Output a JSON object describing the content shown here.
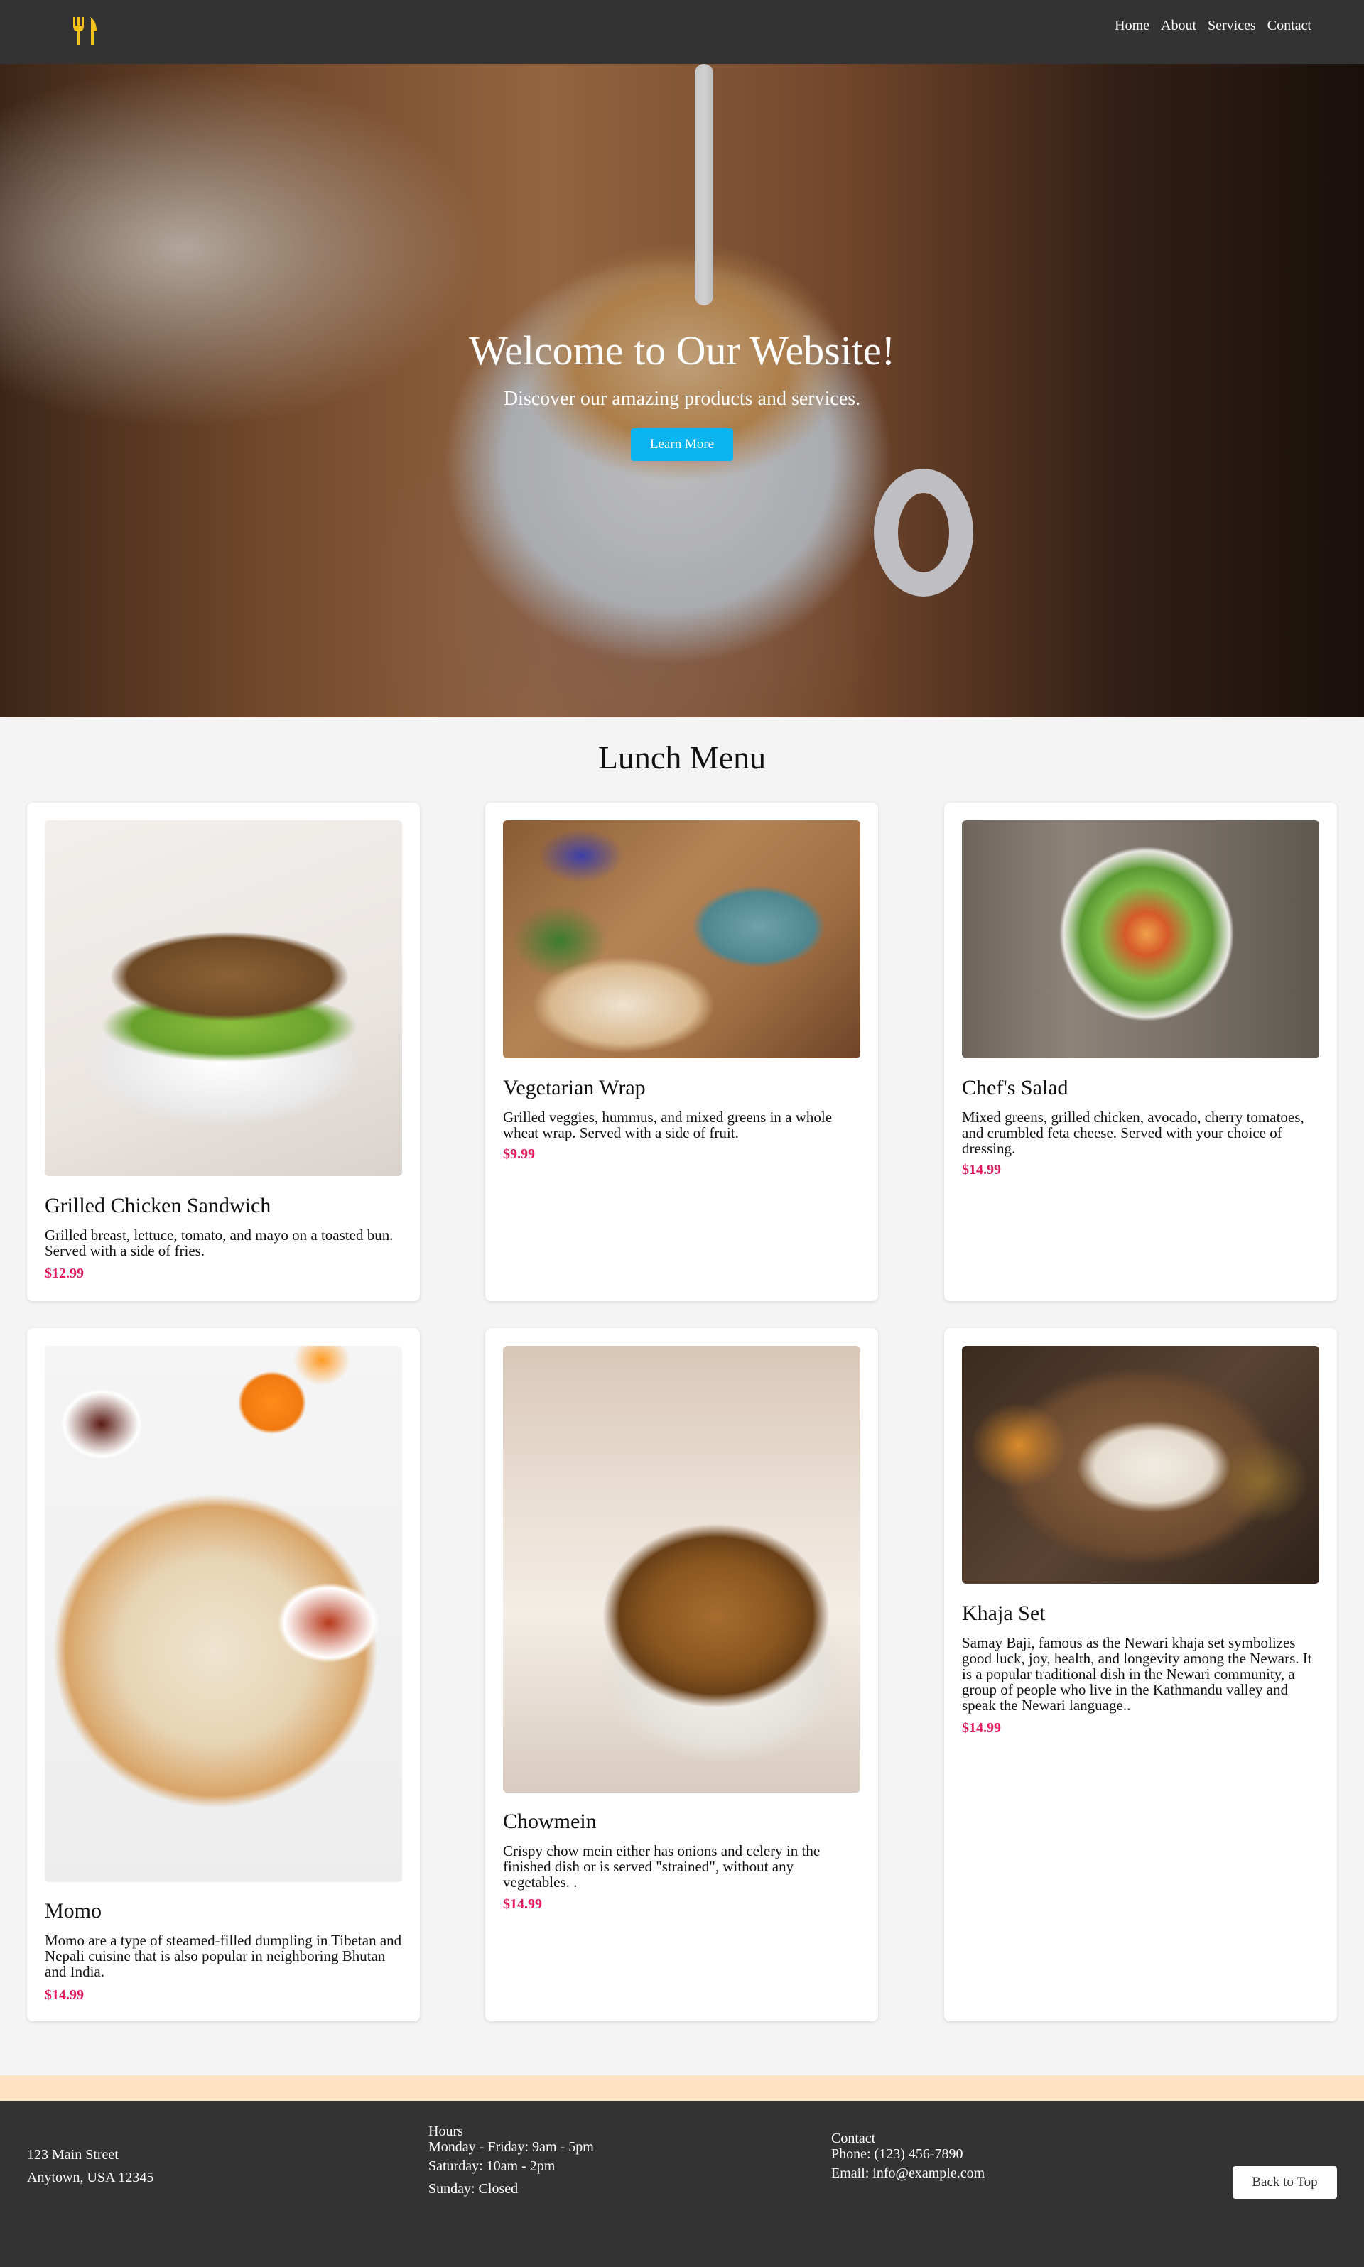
{
  "nav": {
    "logo_icon": "fork-knife-icon",
    "logo_color": "#f5c21b",
    "links": [
      "Home",
      "About",
      "Services",
      "Contact"
    ]
  },
  "hero": {
    "title": "Welcome to Our Website!",
    "subtitle": "Discover our amazing products and services.",
    "button_label": "Learn More",
    "button_color": "#0ab4f0"
  },
  "menu": {
    "title": "Lunch Menu",
    "items": [
      {
        "name": "Grilled Chicken Sandwich",
        "description": "Grilled breast, lettuce, tomato, and mayo on a toasted bun. Served with a side of fries.",
        "price": "$12.99"
      },
      {
        "name": "Vegetarian Wrap",
        "description": "Grilled veggies, hummus, and mixed greens in a whole wheat wrap. Served with a side of fruit.",
        "price": "$9.99"
      },
      {
        "name": "Chef's Salad",
        "description": "Mixed greens, grilled chicken, avocado, cherry tomatoes, and crumbled feta cheese. Served with your choice of dressing.",
        "price": "$14.99"
      },
      {
        "name": "Momo",
        "description": "Momo are a type of steamed-filled dumpling in Tibetan and Nepali cuisine that is also popular in neighboring Bhutan and India.",
        "price": "$14.99"
      },
      {
        "name": "Chowmein",
        "description": "Crispy chow mein either has onions and celery in the finished dish or is served \"strained\", without any vegetables. .",
        "price": "$14.99"
      },
      {
        "name": "Khaja Set",
        "description": "Samay Baji, famous as the Newari khaja set symbolizes good luck, joy, health, and longevity among the Newars. It is a popular traditional dish in the Newari community, a group of people who live in the Kathmandu valley and speak the Newari language..",
        "price": "$14.99"
      }
    ],
    "price_color": "#e2195b"
  },
  "footer": {
    "address": [
      "123 Main Street",
      "Anytown, USA 12345"
    ],
    "hours_title": "Hours",
    "hours": [
      "Monday - Friday: 9am - 5pm",
      "Saturday: 10am - 2pm",
      "Sunday: Closed"
    ],
    "contact_title": "Contact",
    "phone": "Phone: (123) 456-7890",
    "email": "Email: info@example.com",
    "back_to_top": "Back to Top"
  }
}
